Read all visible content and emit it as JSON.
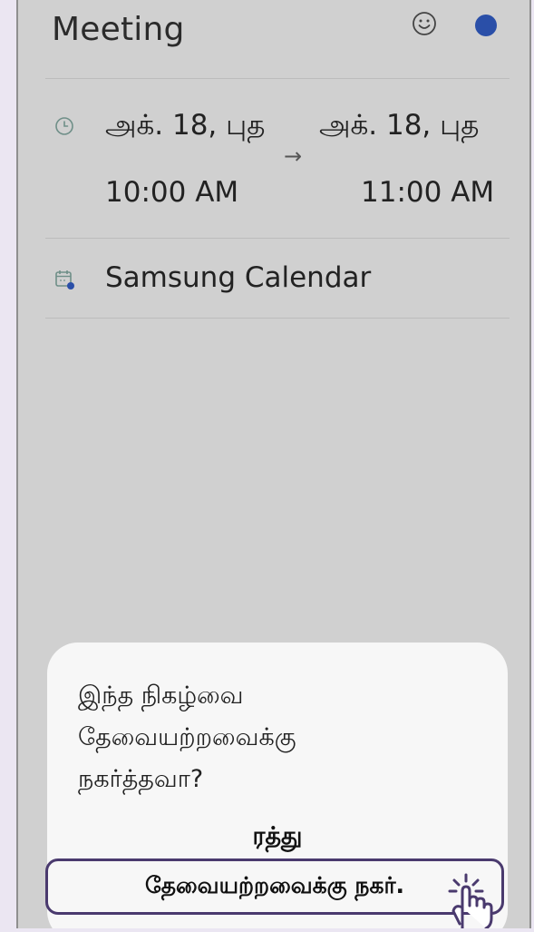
{
  "event": {
    "title": "Meeting",
    "start_date": "அக். 18, புத",
    "start_time": "10:00 AM",
    "end_date": "அக். 18, புத",
    "end_time": "11:00 AM",
    "arrow": "→",
    "calendar": "Samsung Calendar",
    "color": "#2a4fa8"
  },
  "dialog": {
    "message": "இந்த நிகழ்வை தேவையற்றவைக்கு நகர்த்தவா?",
    "cancel_label": "ரத்து",
    "move_label": "தேவையற்றவைக்கு நகர்."
  },
  "icons": [
    "emoji-icon",
    "clock-icon",
    "calendar-icon",
    "pointer-hand-icon"
  ]
}
